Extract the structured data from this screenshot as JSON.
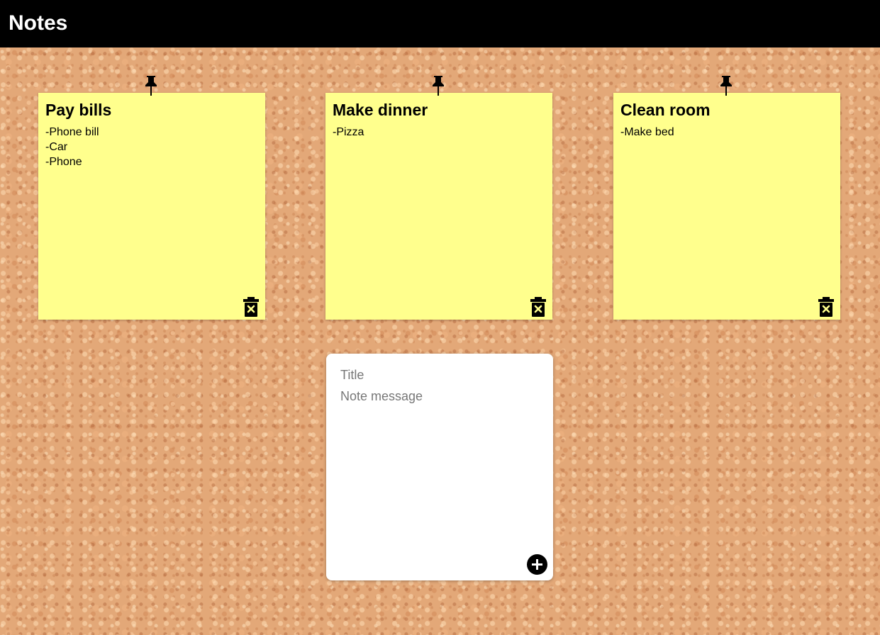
{
  "header": {
    "title": "Notes"
  },
  "notes": [
    {
      "title": "Pay bills",
      "lines": [
        "-Phone bill",
        "-Car",
        "-Phone"
      ],
      "pin_icon": "pushpin-icon",
      "delete_icon": "trash-icon"
    },
    {
      "title": "Make dinner",
      "lines": [
        "-Pizza"
      ],
      "pin_icon": "pushpin-icon",
      "delete_icon": "trash-icon"
    },
    {
      "title": "Clean room",
      "lines": [
        "-Make bed"
      ],
      "pin_icon": "pushpin-icon",
      "delete_icon": "trash-icon"
    }
  ],
  "composer": {
    "title_placeholder": "Title",
    "title_value": "",
    "message_placeholder": "Note message",
    "message_value": "",
    "add_icon": "plus-circle-icon"
  },
  "colors": {
    "header_bg": "#000000",
    "note_bg": "#ffff8d",
    "board_bg": "#e3a878"
  }
}
